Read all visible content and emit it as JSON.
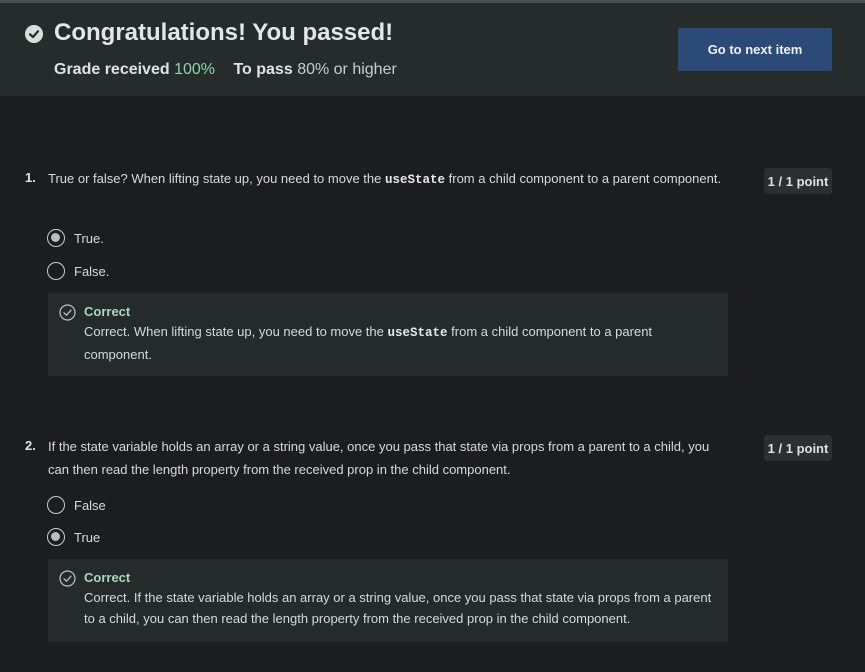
{
  "banner": {
    "title": "Congratulations! You passed!",
    "grade_label": "Grade received",
    "grade_value": "100%",
    "pass_label": "To pass",
    "pass_value": "80% or higher",
    "next_button": "Go to next item"
  },
  "questions": [
    {
      "number": "1.",
      "text_before": "True or false? When lifting state up, you need to move the",
      "code": "useState",
      "text_after": "from a child component to a parent component.",
      "points": "1 / 1 point",
      "options": [
        {
          "label": "True.",
          "selected": true
        },
        {
          "label": "False.",
          "selected": false
        }
      ],
      "feedback": {
        "title": "Correct",
        "text_before": "Correct. When lifting state up, you need to move the",
        "code": "useState",
        "text_after": "from a child component to a parent component."
      }
    },
    {
      "number": "2.",
      "text": "If the state variable holds an array or a string value, once you pass that state via props from a parent to a child, you can then read the length property from the received prop in the child component.",
      "points": "1 / 1 point",
      "options": [
        {
          "label": "False",
          "selected": false
        },
        {
          "label": "True",
          "selected": true
        }
      ],
      "feedback": {
        "title": "Correct",
        "text": "Correct. If the state variable holds an array or a string value, once you pass that state via props from a parent to a child, you can then read the length property from the received prop in the child component."
      }
    }
  ],
  "colors": {
    "background": "#1b1d1e",
    "banner": "#262b2c",
    "accent_button": "#2b4a78",
    "correct_green": "#a7d9be",
    "grade_green": "#8fd3b0"
  }
}
